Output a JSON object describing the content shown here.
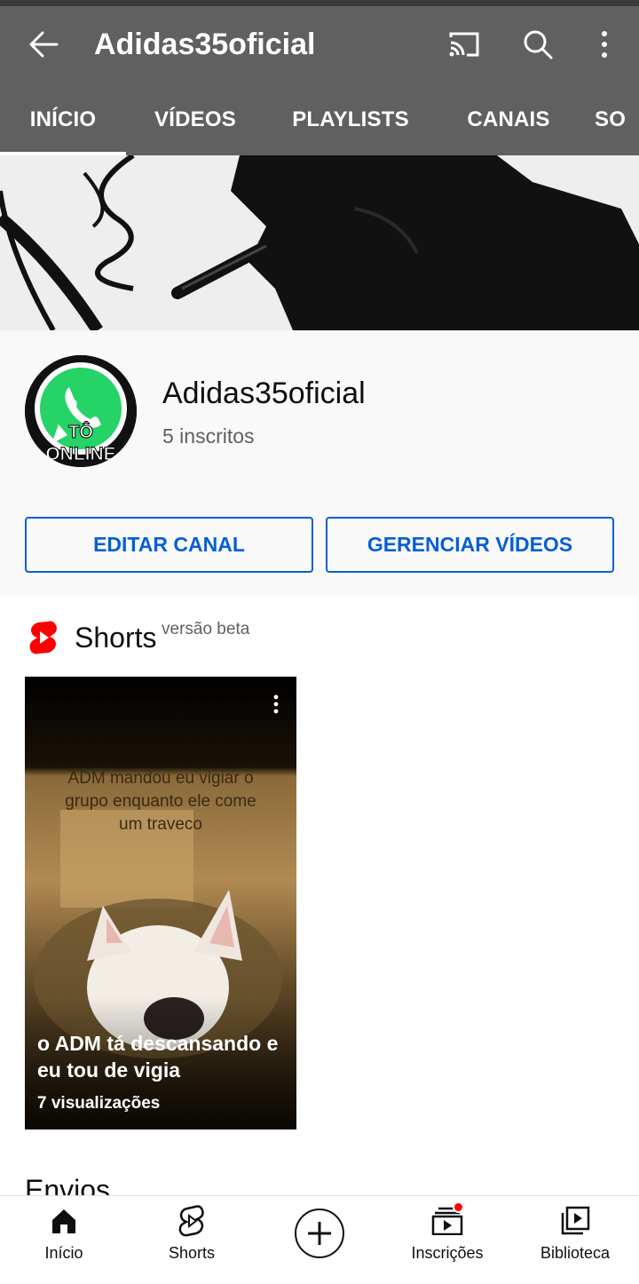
{
  "header": {
    "title": "Adidas35oficial",
    "back_icon": "arrow-left-icon",
    "cast_icon": "cast-icon",
    "search_icon": "search-icon",
    "more_icon": "more-vert-icon"
  },
  "tabs": [
    {
      "label": "INÍCIO",
      "selected": true
    },
    {
      "label": "VÍDEOS",
      "selected": false
    },
    {
      "label": "PLAYLISTS",
      "selected": false
    },
    {
      "label": "CANAIS",
      "selected": false
    },
    {
      "label": "SO",
      "selected": false
    }
  ],
  "channel": {
    "name": "Adidas35oficial",
    "subscribers": "5 inscritos",
    "avatar_text": "TÔ ONLINE",
    "edit_button": "EDITAR CANAL",
    "manage_button": "GERENCIAR VÍDEOS"
  },
  "shorts_section": {
    "title": "Shorts",
    "badge": "versão beta",
    "items": [
      {
        "title": "o ADM tá descansando e eu tou de vigia",
        "views": "7 visualizações",
        "overlay_text": "ADM mandou eu vigiar o grupo enquanto ele come um traveco"
      }
    ]
  },
  "uploads_section": {
    "title": "Envios"
  },
  "bottom_nav": {
    "home": "Início",
    "shorts": "Shorts",
    "create_icon": "plus-circle-icon",
    "subscriptions": "Inscrições",
    "library": "Biblioteca",
    "subscriptions_has_notification": true
  },
  "colors": {
    "appbar": "#606060",
    "accent_blue": "#065fd4",
    "shorts_red": "#ff0000",
    "notification_red": "#ff0000"
  }
}
